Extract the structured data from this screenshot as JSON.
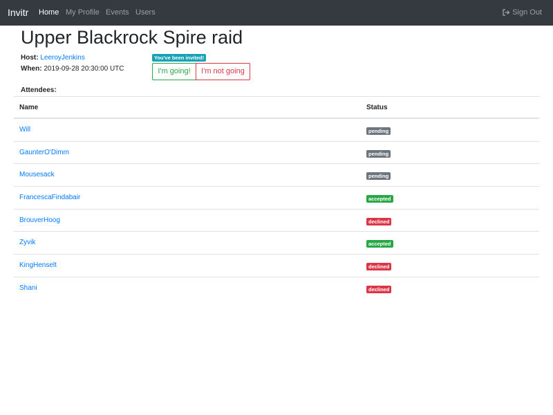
{
  "nav": {
    "brand": "Invitr",
    "links": [
      {
        "label": "Home",
        "active": true
      },
      {
        "label": "My Profile",
        "active": false
      },
      {
        "label": "Events",
        "active": false
      },
      {
        "label": "Users",
        "active": false
      }
    ],
    "signout": "Sign Out",
    "signout_icon": "sign-out-icon"
  },
  "event": {
    "title": "Upper Blackrock Spire raid",
    "host_label": "Host:",
    "host_name": "LeeroyJenkins",
    "when_label": "When:",
    "when_value": "2019-09-28 20:30:00 UTC",
    "invited_badge": "You've been invited!",
    "going_button": "I'm going!",
    "not_going_button": "I'm not going"
  },
  "attendees": {
    "label": "Attendees:",
    "columns": [
      "Name",
      "Status"
    ],
    "rows": [
      {
        "name": "Will",
        "status": "pending"
      },
      {
        "name": "GaunterO'Dimm",
        "status": "pending"
      },
      {
        "name": "Mousesack",
        "status": "pending"
      },
      {
        "name": "FrancescaFindabair",
        "status": "accepted"
      },
      {
        "name": "BrouverHoog",
        "status": "declined"
      },
      {
        "name": "Zyvik",
        "status": "accepted"
      },
      {
        "name": "KingHenselt",
        "status": "declined"
      },
      {
        "name": "Shani",
        "status": "declined"
      }
    ]
  },
  "colors": {
    "navbar": "#343a40",
    "link": "#007bff",
    "pending": "#6c757d",
    "accepted": "#28a745",
    "declined": "#dc3545",
    "info": "#17a2b8"
  }
}
